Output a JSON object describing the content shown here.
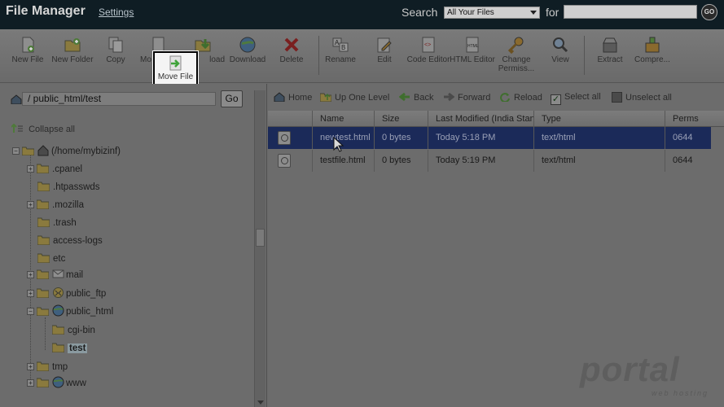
{
  "header": {
    "title": "File Manager",
    "settings_label": "Settings",
    "search_label": "Search",
    "search_scope": "All Your Files",
    "for_label": "for",
    "search_value": "",
    "go_label": "GO"
  },
  "toolbar": {
    "items": [
      {
        "label": "New File",
        "icon": "new-file-icon"
      },
      {
        "label": "New Folder",
        "icon": "new-folder-icon"
      },
      {
        "label": "Copy",
        "icon": "copy-icon"
      },
      {
        "label": "Mo",
        "icon": "move-icon"
      },
      {
        "label": "load",
        "icon": "upload-icon"
      },
      {
        "label": "Download",
        "icon": "download-icon"
      },
      {
        "label": "Delete",
        "icon": "delete-icon"
      },
      {
        "label": "Rename",
        "icon": "rename-icon"
      },
      {
        "label": "Edit",
        "icon": "edit-icon"
      },
      {
        "label": "Code Editor",
        "icon": "code-editor-icon"
      },
      {
        "label": "HTML Editor",
        "icon": "html-editor-icon"
      },
      {
        "label": "Change Permiss...",
        "icon": "permissions-icon"
      },
      {
        "label": "View",
        "icon": "view-icon"
      },
      {
        "label": "Extract",
        "icon": "extract-icon"
      },
      {
        "label": "Compre...",
        "icon": "compress-icon"
      }
    ],
    "move_file_label": "Move File"
  },
  "left": {
    "path": "/ public_html/test",
    "go_label": "Go",
    "collapse_label": "Collapse all",
    "tree": [
      {
        "label": "(/home/mybizinf)"
      },
      {
        "label": ".cpanel"
      },
      {
        "label": ".htpasswds"
      },
      {
        "label": ".mozilla"
      },
      {
        "label": ".trash"
      },
      {
        "label": "access-logs"
      },
      {
        "label": "etc"
      },
      {
        "label": "mail"
      },
      {
        "label": "public_ftp"
      },
      {
        "label": "public_html"
      },
      {
        "label": "cgi-bin"
      },
      {
        "label": "test"
      },
      {
        "label": "tmp"
      },
      {
        "label": "www"
      }
    ]
  },
  "nav": {
    "home": "Home",
    "up": "Up One Level",
    "back": "Back",
    "forward": "Forward",
    "reload": "Reload",
    "select_all": "Select all",
    "unselect_all": "Unselect all"
  },
  "table": {
    "headers": [
      "Name",
      "Size",
      "Last Modified (India Stand",
      "Type",
      "Perms"
    ],
    "rows": [
      {
        "name": "newtest.html",
        "size": "0 bytes",
        "modified": "Today 5:18 PM",
        "type": "text/html",
        "perms": "0644",
        "selected": true
      },
      {
        "name": "testfile.html",
        "size": "0 bytes",
        "modified": "Today 5:19 PM",
        "type": "text/html",
        "perms": "0644",
        "selected": false
      }
    ]
  },
  "watermark": {
    "brand": "portal",
    "sub": "web hosting"
  }
}
